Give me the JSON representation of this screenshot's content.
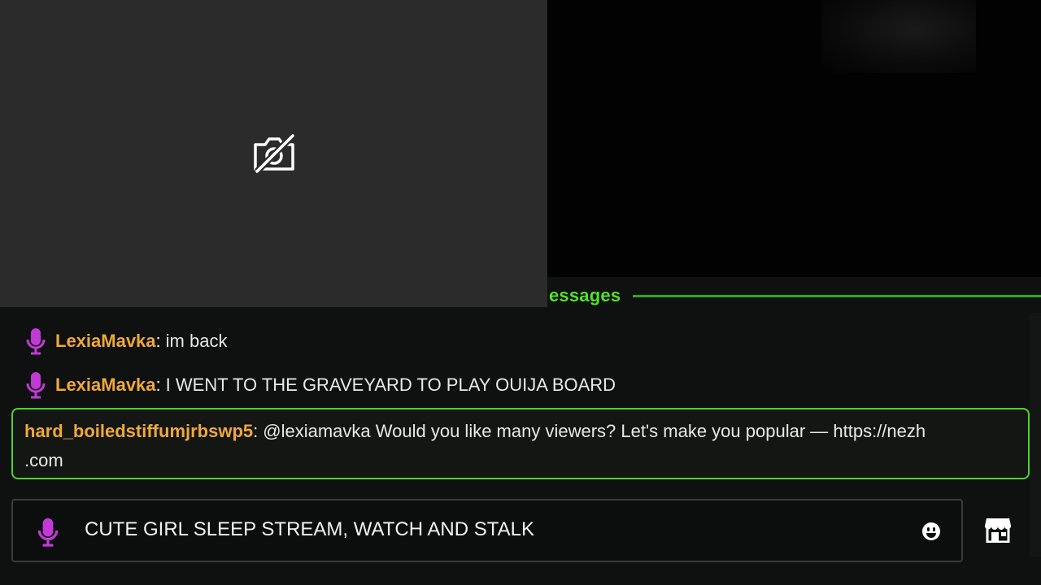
{
  "camera_panel": {
    "icon": "camera-off-icon"
  },
  "chat": {
    "section_label": "essages",
    "messages": [
      {
        "user": "LexiaMavka",
        "separator": ":",
        "text": "im back",
        "badge": "mic-icon"
      },
      {
        "user": "LexiaMavka",
        "separator": ":",
        "text": "I WENT TO THE GRAVEYARD TO PLAY OUIJA BOARD",
        "badge": "mic-icon"
      }
    ],
    "highlighted": {
      "user": "hard_boiledstiffumjrbswp5",
      "separator": ":",
      "text_line1": "@lexiamavka Would you like many viewers? Let's make you popular — https://nezh",
      "text_line2": ".com"
    }
  },
  "input": {
    "value": "CUTE GIRL SLEEP STREAM, WATCH AND STALK",
    "mic_icon": "mic-icon",
    "emoji_icon": "emoji-icon"
  },
  "toolbar": {
    "store_icon": "store-icon"
  },
  "colors": {
    "accent_green": "#4cd431",
    "username": "#f0a83a",
    "mic_purple": "#c23ad6"
  }
}
